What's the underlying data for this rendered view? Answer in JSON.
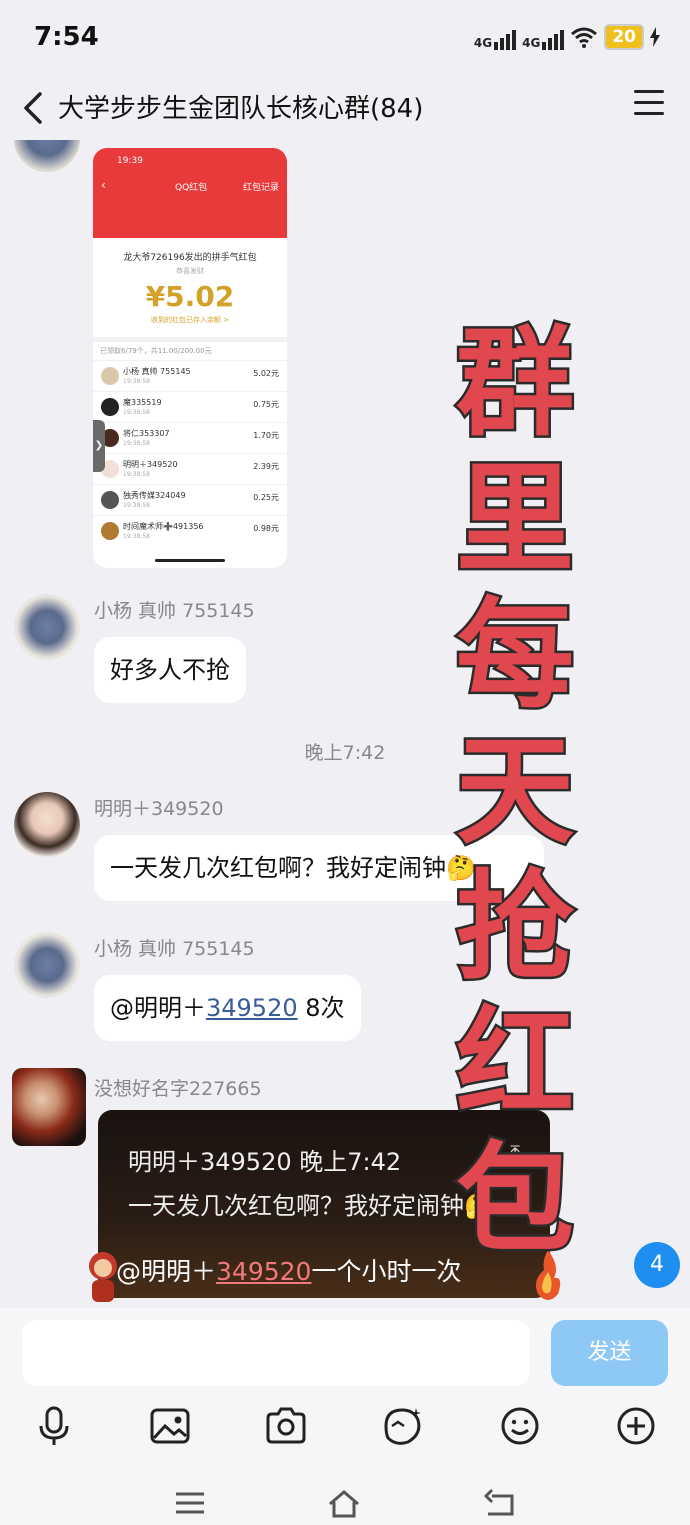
{
  "status_bar": {
    "time": "7:54",
    "network1": "4G",
    "network2": "4G",
    "battery": "20"
  },
  "header": {
    "title": "大学步步生金团队长核心群(84)"
  },
  "screenshot_card": {
    "time": "19:39",
    "nav_title": "QQ红包",
    "nav_right": "红包记录",
    "title": "龙大爷726196发出的拼手气红包",
    "subtitle": "恭喜发财",
    "amount": "¥5.02",
    "note": "收到的红包已存入余额 >",
    "meta": "已领取6/79个，共11.00/200.00元",
    "rows": [
      {
        "name": "小杨 真帅 755145",
        "time": "19:38:59",
        "value": "5.02元"
      },
      {
        "name": "魔335519",
        "time": "19:38:58",
        "value": "0.75元"
      },
      {
        "name": "将仁353307",
        "time": "19:38:58",
        "value": "1.70元"
      },
      {
        "name": "明明＋349520",
        "time": "19:38:58",
        "value": "2.39元"
      },
      {
        "name": "独秀传媒324049",
        "time": "19:38:58",
        "value": "0.25元"
      },
      {
        "name": "时间魔术师➕491356",
        "time": "19:38:58",
        "value": "0.98元"
      }
    ]
  },
  "messages": [
    {
      "sender": "小杨 真帅 755145",
      "text": "好多人不抢"
    },
    {
      "sender": "明明＋349520",
      "text": "一天发几次红包啊？我好定闹钟🤔"
    },
    {
      "sender": "小杨 真帅 755145",
      "mention": "@明明＋",
      "link": "349520",
      "suffix": " 8次"
    },
    {
      "sender": "没想好名字227665"
    }
  ],
  "time_separator": "晚上7:42",
  "quote": {
    "line1": "明明＋349520 晚上7:42",
    "line2": "一天发几次红包啊？我好定闹钟🤔",
    "arrow": "⤒",
    "reply_prefix": "@明明＋",
    "reply_link": "349520",
    "reply_suffix": "一个小时一次"
  },
  "overlay_chars": [
    "群",
    "里",
    "每",
    "天",
    "抢",
    "红",
    "包"
  ],
  "unread_count": "4",
  "input": {
    "placeholder": "",
    "send_label": "发送"
  },
  "colors": {
    "accent": "#1e8ef0",
    "overlay_red": "#e0474f",
    "send_bg": "#8ec9f6"
  }
}
